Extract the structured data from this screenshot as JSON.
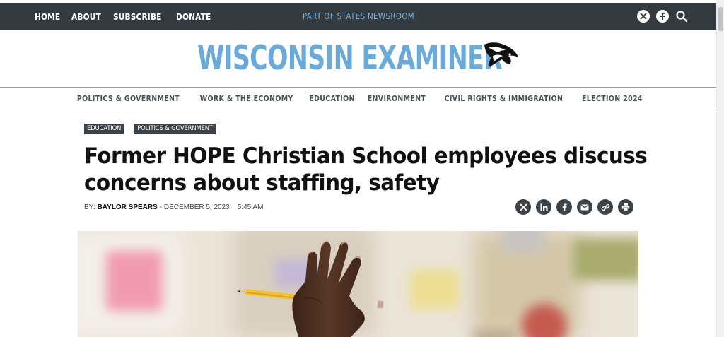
{
  "topbar": {
    "nav": [
      "HOME",
      "ABOUT",
      "SUBSCRIBE",
      "DONATE"
    ],
    "network": "PART OF STATES NEWSROOM",
    "icons": [
      "x-icon",
      "facebook-icon",
      "search-icon"
    ]
  },
  "masthead": {
    "logo_text": "WISCONSIN EXAMINER"
  },
  "sections": [
    "POLITICS & GOVERNMENT",
    "WORK & THE ECONOMY",
    "EDUCATION",
    "ENVIRONMENT",
    "CIVIL RIGHTS & IMMIGRATION",
    "ELECTION 2024"
  ],
  "article": {
    "tags": [
      "EDUCATION",
      "POLITICS & GOVERNMENT"
    ],
    "headline_line1": "Former HOPE Christian School employees discuss",
    "headline_line2": "concerns about staffing, safety",
    "by_label": "BY:",
    "author": "BAYLOR SPEARS",
    "date": "- DECEMBER 5, 2023",
    "time": "5:45 AM",
    "share_icons": [
      "x-icon",
      "linkedin-icon",
      "facebook-icon",
      "email-icon",
      "link-icon",
      "print-icon"
    ]
  },
  "colors": {
    "topbar_bg": "#333b40",
    "brand_blue": "#6aaad8",
    "tag_bg": "#3c4246"
  }
}
